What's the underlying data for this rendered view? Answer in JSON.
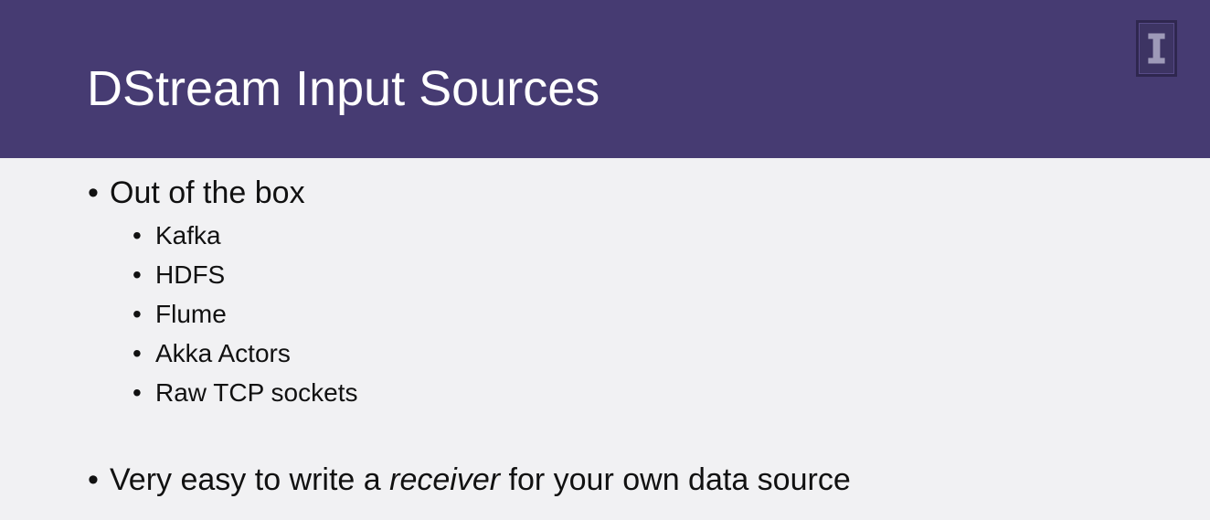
{
  "slide": {
    "title": "DStream Input Sources",
    "colors": {
      "header_bg": "#463b72",
      "body_bg": "#f1f1f3",
      "title_text": "#ffffff",
      "body_text": "#111111"
    },
    "logo": {
      "icon": "block-i-logo-icon"
    },
    "bullets": [
      {
        "text": "Out of the box",
        "children": [
          "Kafka",
          "HDFS",
          "Flume",
          "Akka Actors",
          "Raw TCP sockets"
        ]
      },
      {
        "text_before": "Very easy to write a ",
        "text_emphasis": "receiver",
        "text_after": " for your own data source"
      }
    ],
    "bullet_glyph": "•"
  }
}
